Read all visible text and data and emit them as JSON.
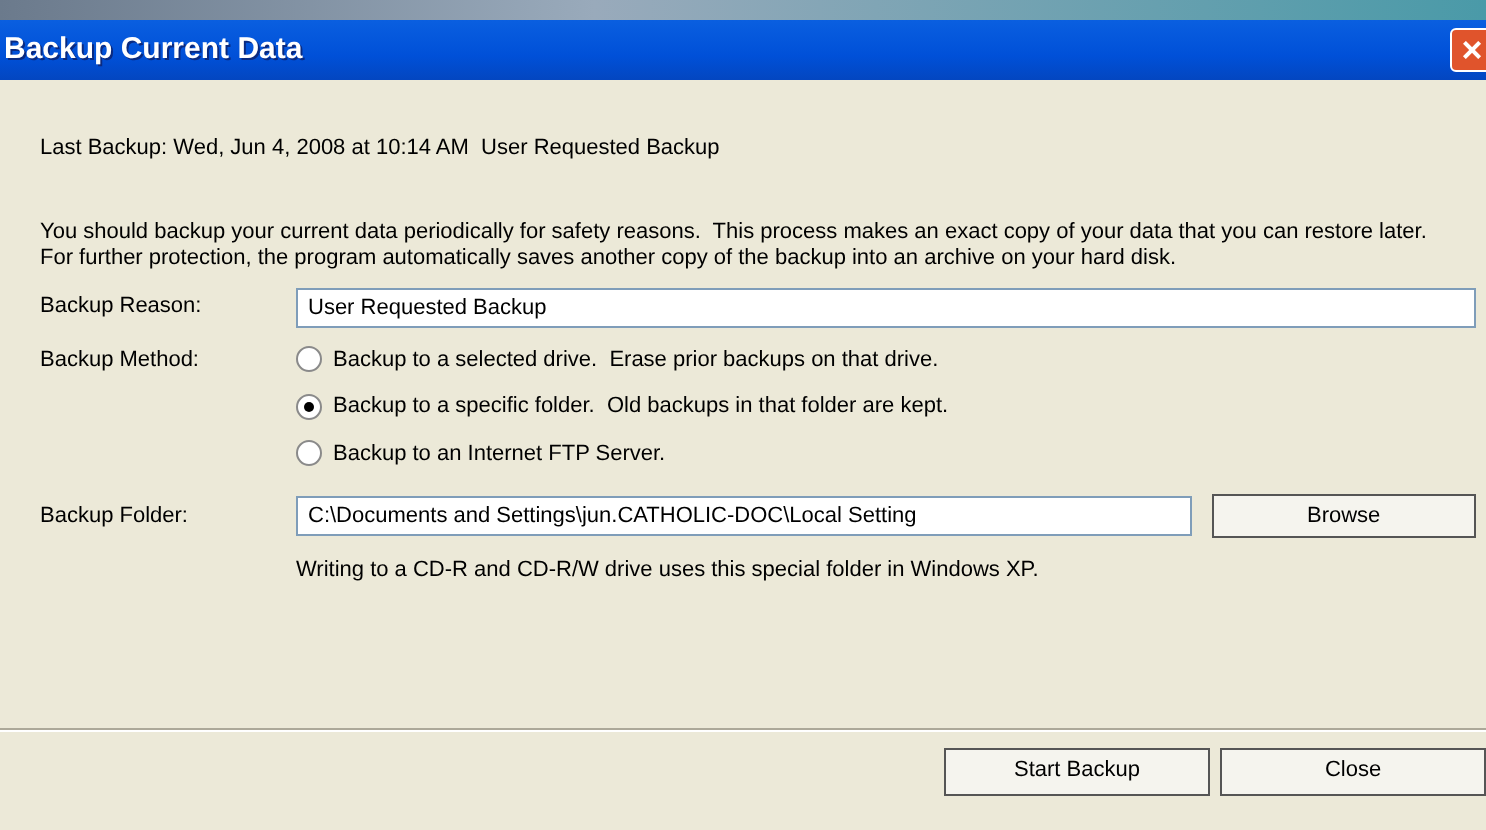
{
  "window": {
    "title": "Backup Current Data",
    "close_glyph": "×"
  },
  "last_backup": "Last Backup: Wed, Jun 4, 2008 at 10:14 AM  User Requested Backup",
  "description": "You should backup your current data periodically for safety reasons.  This process makes an exact copy of your data that you can restore later.  For further protection, the program automatically saves another copy of the backup into an archive on your hard disk.",
  "reason": {
    "label": "Backup Reason:",
    "value": "User Requested Backup"
  },
  "method": {
    "label": "Backup Method:",
    "options": [
      {
        "label": "Backup to a selected drive.  Erase prior backups on that drive.",
        "selected": false
      },
      {
        "label": "Backup to a specific folder.  Old backups in that folder are kept.",
        "selected": true
      },
      {
        "label": "Backup to an Internet FTP Server.",
        "selected": false
      }
    ]
  },
  "folder": {
    "label": "Backup Folder:",
    "value": "C:\\Documents and Settings\\jun.CATHOLIC-DOC\\Local Setting",
    "browse": "Browse",
    "note": "Writing to a CD-R and CD-R/W drive uses this special folder in Windows XP."
  },
  "buttons": [
    "Start Backup",
    "Close"
  ]
}
